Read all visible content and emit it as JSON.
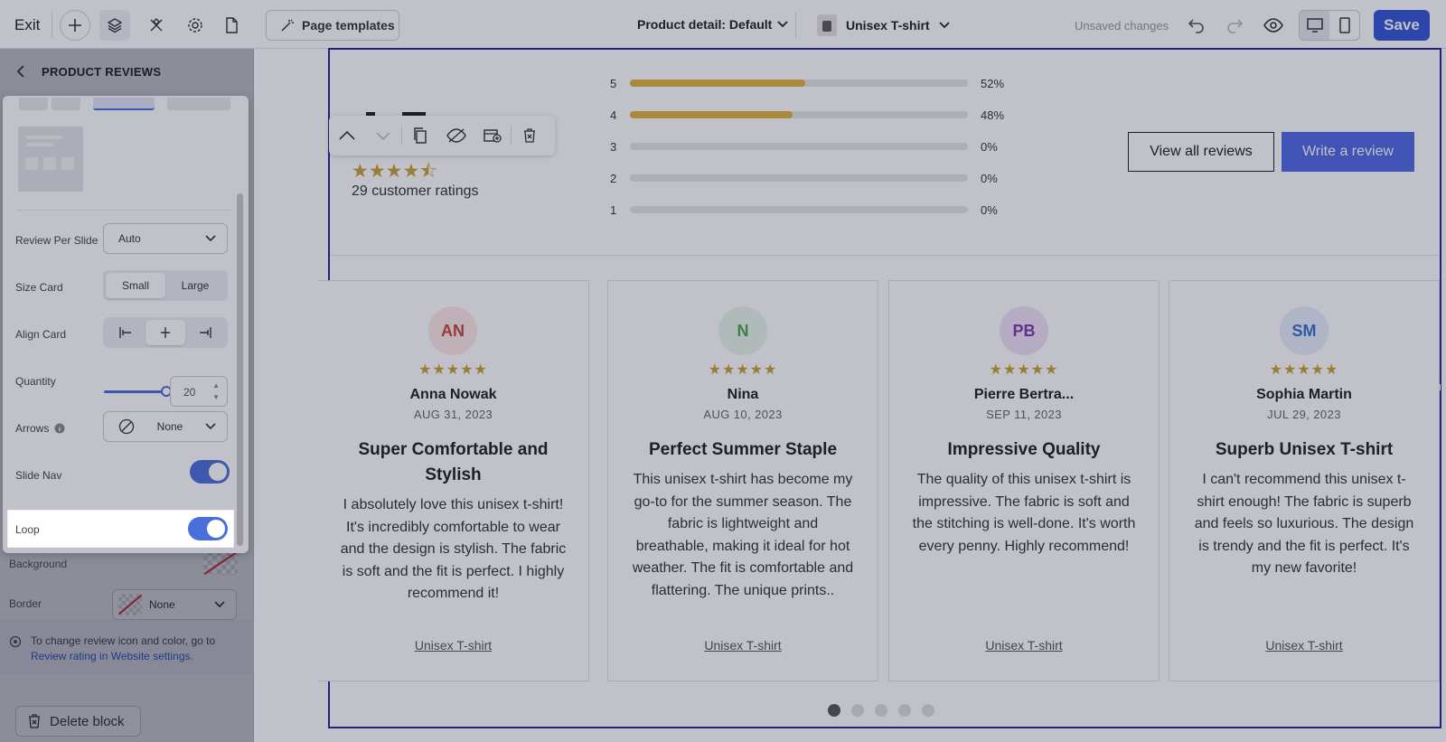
{
  "topbar": {
    "exit_label": "Exit",
    "page_templates_label": "Page templates",
    "page_selector": "Product detail: Default",
    "product_selector": "Unisex T-shirt",
    "unsaved_label": "Unsaved changes",
    "save_label": "Save"
  },
  "sidebar": {
    "title": "PRODUCT REVIEWS",
    "background_label": "Background",
    "border_label": "Border",
    "border_value": "None",
    "info_text": "To change review icon and color, go to",
    "info_link": "Review rating in Website settings.",
    "delete_label": "Delete block"
  },
  "panel": {
    "review_per_slide_label": "Review Per Slide",
    "review_per_slide_value": "Auto",
    "size_card_label": "Size Card",
    "size_options": [
      "Small",
      "Large"
    ],
    "size_selected": "Small",
    "align_card_label": "Align Card",
    "quantity_label": "Quantity",
    "quantity_value": "20",
    "arrows_label": "Arrows",
    "arrows_value": "None",
    "slide_nav_label": "Slide Nav",
    "slide_nav_on": true,
    "loop_label": "Loop",
    "loop_on": true
  },
  "summary": {
    "rating_stars": "★★★★⯪",
    "total_label": "29 customer ratings",
    "distribution": [
      {
        "star": "5",
        "percent": 52,
        "label": "52%"
      },
      {
        "star": "4",
        "percent": 48,
        "label": "48%"
      },
      {
        "star": "3",
        "percent": 0,
        "label": "0%"
      },
      {
        "star": "2",
        "percent": 0,
        "label": "0%"
      },
      {
        "star": "1",
        "percent": 0,
        "label": "0%"
      }
    ],
    "view_all_label": "View all reviews",
    "write_label": "Write a review"
  },
  "reviews": [
    {
      "initials": "AN",
      "avatar_bg": "#fde9e7",
      "avatar_fg": "#c7463c",
      "stars": "★★★★★",
      "name": "Anna Nowak",
      "date": "AUG 31, 2023",
      "title": "Super Comfortable and Stylish",
      "body": "I absolutely love this unisex t-shirt! It's incredibly comfortable to wear and the design is stylish. The fabric is soft and the fit is perfect. I highly recommend it!",
      "product": "Unisex T-shirt"
    },
    {
      "initials": "N",
      "avatar_bg": "#e8f6e8",
      "avatar_fg": "#4aa64a",
      "stars": "★★★★★",
      "name": "Nina",
      "date": "AUG 10, 2023",
      "title": "Perfect Summer Staple",
      "body": "This unisex t-shirt has become my go-to for the summer season. The fabric is lightweight and breathable, making it ideal for hot weather. The fit is comfortable and flattering. The unique prints..",
      "product": "Unisex T-shirt"
    },
    {
      "initials": "PB",
      "avatar_bg": "#efe3f7",
      "avatar_fg": "#7a3bb0",
      "stars": "★★★★★",
      "name": "Pierre Bertra...",
      "date": "SEP 11, 2023",
      "title": "Impressive Quality",
      "body": "The quality of this unisex t-shirt is impressive. The fabric is soft and the stitching is well-done. It's worth every penny. Highly recommend!",
      "product": "Unisex T-shirt"
    },
    {
      "initials": "SM",
      "avatar_bg": "#e6eefb",
      "avatar_fg": "#3c6fc8",
      "stars": "★★★★★",
      "name": "Sophia Martin",
      "date": "JUL 29, 2023",
      "title": "Superb Unisex T-shirt",
      "body": "I can't recommend this unisex t-shirt enough! The fabric is superb and feels so luxurious. The design is trendy and the fit is perfect. It's my new favorite!",
      "product": "Unisex T-shirt"
    }
  ],
  "pagination": {
    "count": 5,
    "active": 1
  },
  "colors": {
    "accent": "#3357d6",
    "star": "#c8a235",
    "bar": "#e0b33c",
    "selection": "#2a2598"
  }
}
